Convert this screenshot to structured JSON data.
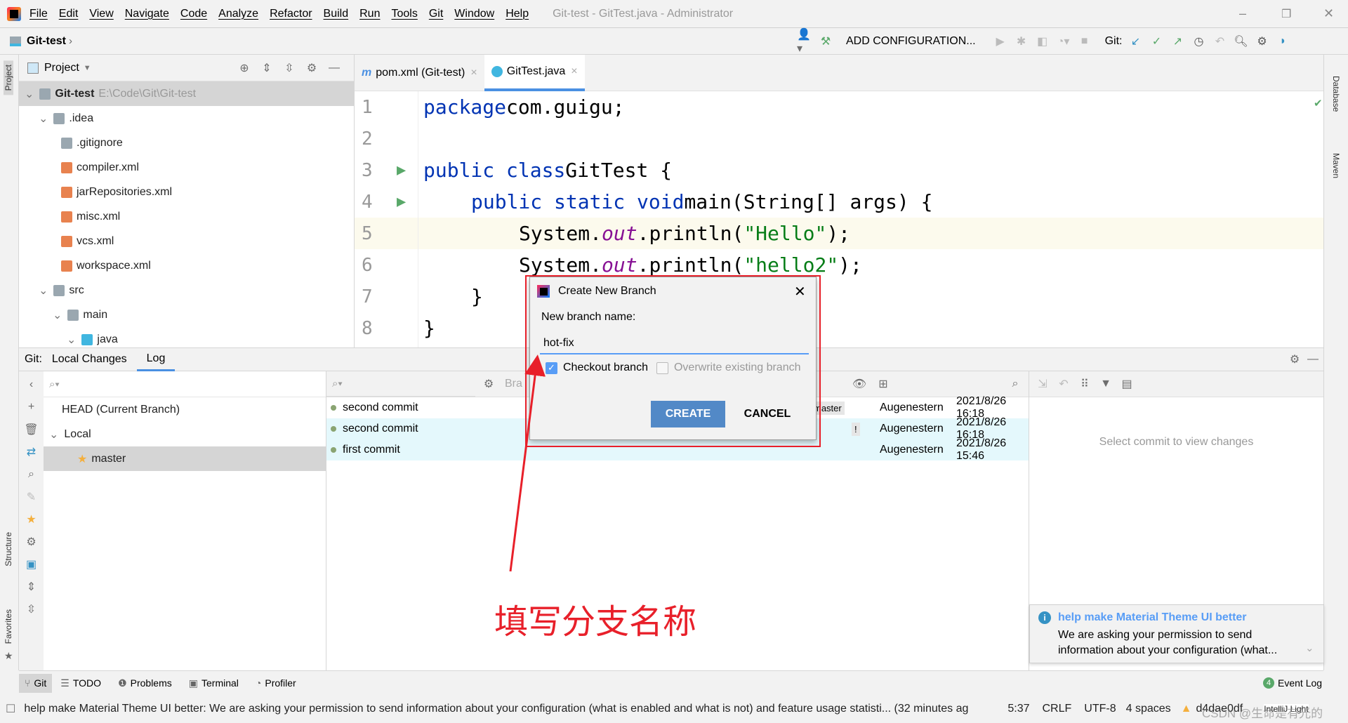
{
  "titlebar": {
    "menu": [
      "File",
      "Edit",
      "View",
      "Navigate",
      "Code",
      "Analyze",
      "Refactor",
      "Build",
      "Run",
      "Tools",
      "Git",
      "Window",
      "Help"
    ],
    "title": "Git-test - GitTest.java - Administrator"
  },
  "navbar": {
    "breadcrumb": "Git-test",
    "add_config": "ADD CONFIGURATION...",
    "git_label": "Git:"
  },
  "side": {
    "project": "Project",
    "structure": "Structure",
    "favorites": "Favorites",
    "database": "Database",
    "maven": "Maven"
  },
  "project": {
    "title": "Project",
    "root_name": "Git-test",
    "root_path": "E:\\Code\\Git\\Git-test",
    "items": [
      {
        "label": ".idea",
        "level": 1,
        "type": "folder"
      },
      {
        "label": ".gitignore",
        "level": 2,
        "type": "ignore"
      },
      {
        "label": "compiler.xml",
        "level": 2,
        "type": "xml"
      },
      {
        "label": "jarRepositories.xml",
        "level": 2,
        "type": "xml"
      },
      {
        "label": "misc.xml",
        "level": 2,
        "type": "xml"
      },
      {
        "label": "vcs.xml",
        "level": 2,
        "type": "xml"
      },
      {
        "label": "workspace.xml",
        "level": 2,
        "type": "xml"
      },
      {
        "label": "src",
        "level": 1,
        "type": "folder"
      },
      {
        "label": "main",
        "level": 2,
        "type": "folder"
      },
      {
        "label": "java",
        "level": 3,
        "type": "srcfolder"
      }
    ]
  },
  "editor": {
    "tabs": [
      {
        "label": "pom.xml (Git-test)",
        "active": false
      },
      {
        "label": "GitTest.java",
        "active": true
      }
    ],
    "lines": [
      "1",
      "2",
      "3",
      "4",
      "5",
      "6",
      "7",
      "8"
    ],
    "code": {
      "l1a": "package",
      "l1b": " com.guigu;",
      "l3a": "public class",
      "l3b": " GitTest {",
      "l4a": "public static void",
      "l4b": " main(String[] args) {",
      "l5a": "System.",
      "l5b": "out",
      "l5c": ".println(",
      "l5d": "\"Hello\"",
      "l5e": ");",
      "l6d": "\"hello2\"",
      "l7": "}",
      "l8": "}"
    }
  },
  "git": {
    "label": "Git:",
    "tabs": [
      {
        "label": "Local Changes",
        "active": false
      },
      {
        "label": "Log",
        "active": true
      }
    ],
    "branches": {
      "head": "HEAD (Current Branch)",
      "local": "Local",
      "master": "master"
    },
    "branch_filter": "Bra",
    "commits": [
      {
        "msg": "second commit",
        "tag": "master",
        "author": "Augenestern",
        "date": "2021/8/26 16:18"
      },
      {
        "msg": "second commit",
        "tag": "!",
        "author": "Augenestern",
        "date": "2021/8/26 16:18"
      },
      {
        "msg": "first commit",
        "tag": "",
        "author": "Augenestern",
        "date": "2021/8/26 15:46"
      }
    ],
    "details_empty": "Select commit to view changes"
  },
  "dialog": {
    "title": "Create New Branch",
    "label": "New branch name:",
    "value": "hot-fix",
    "checkout": "Checkout branch",
    "checkout_checked": true,
    "overwrite": "Overwrite existing branch",
    "overwrite_checked": false,
    "create": "CREATE",
    "cancel": "CANCEL"
  },
  "annotation": {
    "text": "填写分支名称",
    "color": "#e8202a"
  },
  "notification": {
    "title": "help make Material Theme UI better",
    "body": "We are asking your permission to send information about your configuration (what..."
  },
  "bottom_tools": [
    "Git",
    "TODO",
    "Problems",
    "Terminal",
    "Profiler"
  ],
  "event_log": {
    "count": "4",
    "label": "Event Log"
  },
  "status": {
    "message": "help make Material Theme UI better: We are asking your permission to send information about your configuration (what is enabled and what is not) and feature usage statisti... (32 minutes ag",
    "position": "5:37",
    "line_sep": "CRLF",
    "encoding": "UTF-8",
    "indent": "4 spaces",
    "branch": "d4dae0df",
    "theme": "IntelliJ Light",
    "watermark": "CSDN @生命是有光的"
  },
  "colors": {
    "accent": "#4a90e2",
    "create_button": "#5289c7",
    "red": "#e8202a"
  }
}
